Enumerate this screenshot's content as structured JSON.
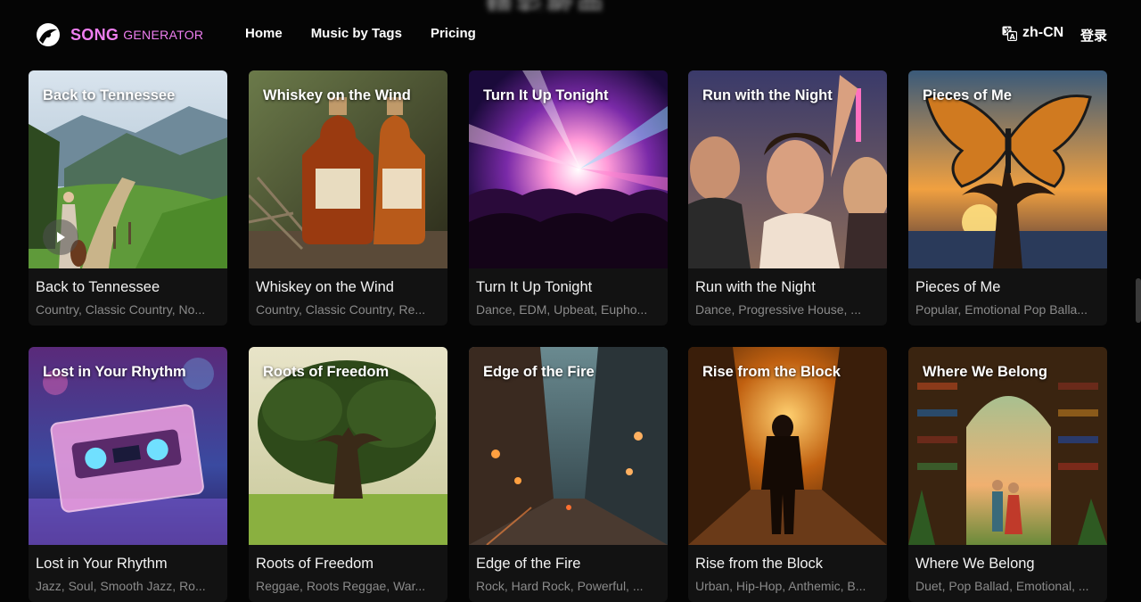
{
  "header": {
    "ghost_text": "精彩歌曲",
    "logo_song": "SONG",
    "logo_generator": "GENERATOR",
    "nav": [
      "Home",
      "Music by Tags",
      "Pricing"
    ],
    "language": "zh-CN",
    "login": "登录"
  },
  "cards": [
    {
      "title": "Back to Tennessee",
      "tags": "Country, Classic Country, No...",
      "scene": "landscape"
    },
    {
      "title": "Whiskey on the Wind",
      "tags": "Country, Classic Country, Re...",
      "scene": "whiskey"
    },
    {
      "title": "Turn It Up Tonight",
      "tags": "Dance, EDM, Upbeat, Eupho...",
      "scene": "concert"
    },
    {
      "title": "Run with the Night",
      "tags": "Dance, Progressive House, ...",
      "scene": "party"
    },
    {
      "title": "Pieces of Me",
      "tags": "Popular, Emotional Pop Balla...",
      "scene": "butterfly"
    },
    {
      "title": "Lost in Your Rhythm",
      "tags": "Jazz, Soul, Smooth Jazz, Ro...",
      "scene": "cassette"
    },
    {
      "title": "Roots of Freedom",
      "tags": "Reggae, Roots Reggae, War...",
      "scene": "tree"
    },
    {
      "title": "Edge of the Fire",
      "tags": "Rock, Hard Rock, Powerful, ...",
      "scene": "street"
    },
    {
      "title": "Rise from the Block",
      "tags": "Urban, Hip-Hop, Anthemic, B...",
      "scene": "alley"
    },
    {
      "title": "Where We Belong",
      "tags": "Duet, Pop Ballad, Emotional, ...",
      "scene": "library"
    }
  ],
  "colors": {
    "accent": "#ee7ef0",
    "background": "#050505",
    "card_bg": "#121212",
    "tag_text": "#8a8a8a"
  }
}
